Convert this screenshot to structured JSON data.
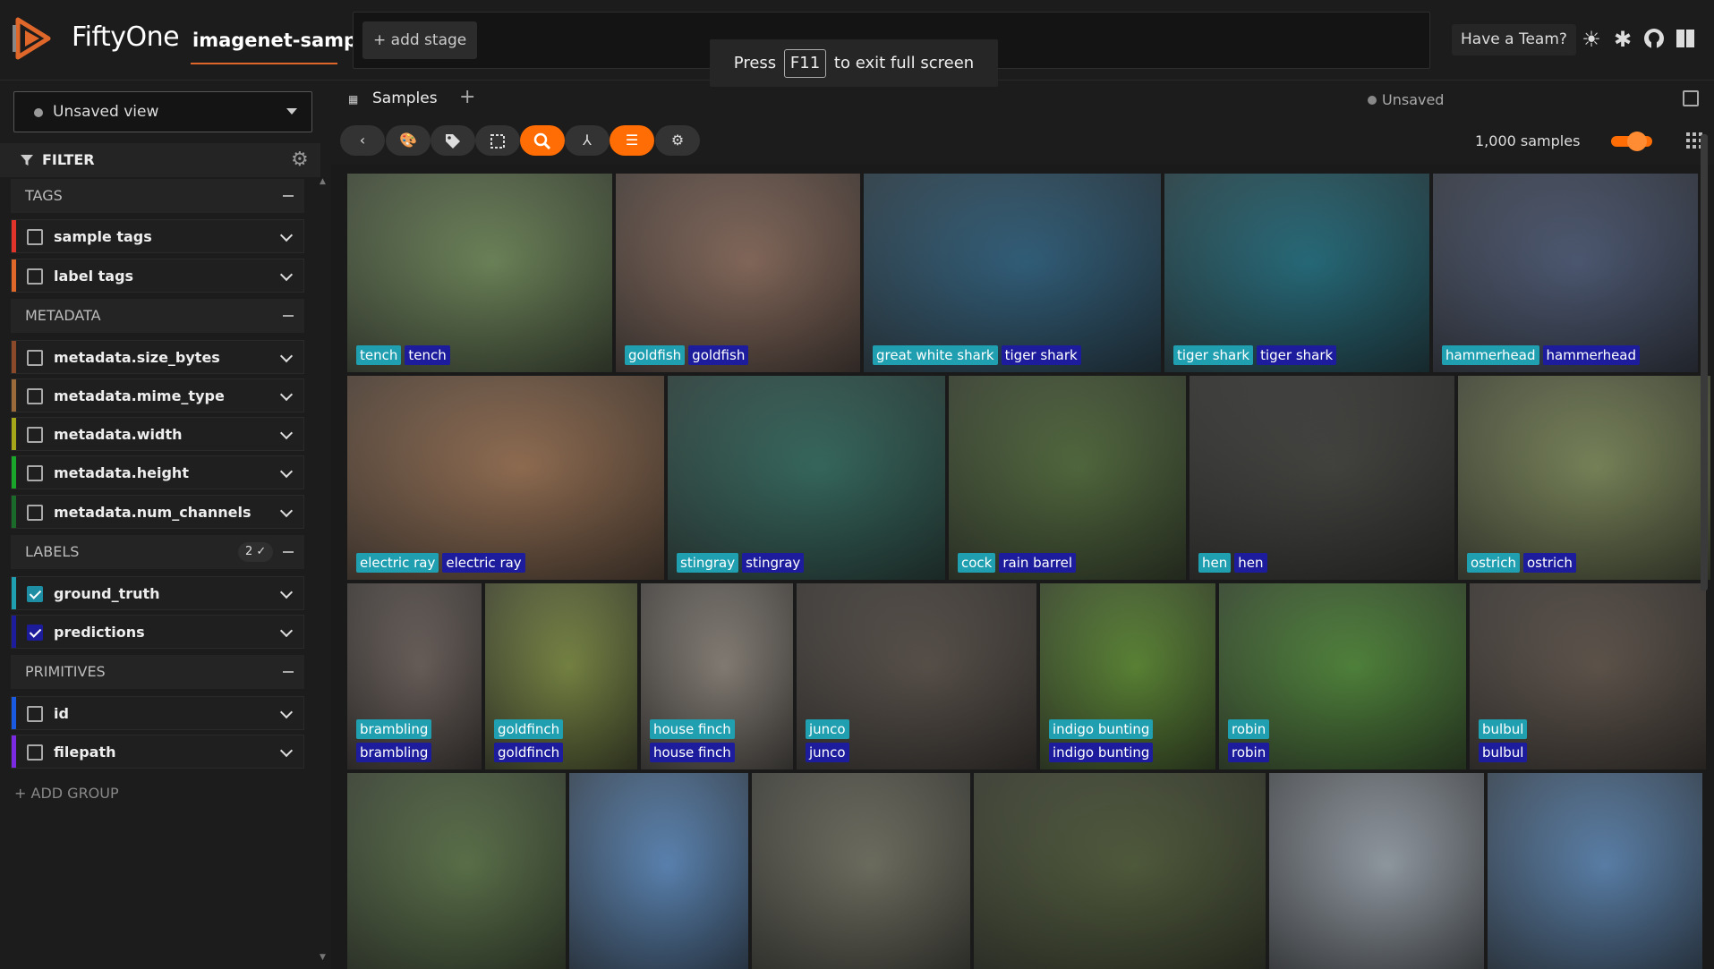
{
  "header": {
    "brand": "FiftyOne",
    "dataset": "imagenet-sample",
    "add_stage": "+ add stage",
    "fullscreen_notice": {
      "before": "Press",
      "key": "F11",
      "after": "to exit full screen"
    },
    "team_button": "Have a Team?",
    "icons": [
      "sun-icon",
      "slack-icon",
      "github-icon",
      "book-icon"
    ]
  },
  "sidebar": {
    "view_selector": "Unsaved view",
    "filter_title": "FILTER",
    "groups": {
      "tags": "TAGS",
      "metadata": "METADATA",
      "labels": "LABELS",
      "labels_badge": "2 ✓",
      "primitives": "PRIMITIVES"
    },
    "fields": {
      "sample_tags": "sample tags",
      "label_tags": "label tags",
      "size_bytes": "metadata.size_bytes",
      "mime_type": "metadata.mime_type",
      "width": "metadata.width",
      "height": "metadata.height",
      "num_channels": "metadata.num_channels",
      "ground_truth": "ground_truth",
      "predictions": "predictions",
      "id": "id",
      "filepath": "filepath"
    },
    "add_group": "+ ADD GROUP"
  },
  "main": {
    "tab": "Samples",
    "tab_add": "+",
    "unsaved": "Unsaved",
    "sample_count": "1,000 samples"
  },
  "colors": {
    "accent": "#ff6d04",
    "ground_truth": "#1f9fb0",
    "predictions": "#1c1c9c"
  },
  "samples": [
    {
      "gt": "tench",
      "pred": "tench",
      "bg": "#6f8a58"
    },
    {
      "gt": "goldfish",
      "pred": "goldfish",
      "bg": "#8a6a5a"
    },
    {
      "gt": "great white shark",
      "pred": "tiger shark",
      "bg": "#2a5f7f"
    },
    {
      "gt": "tiger shark",
      "pred": "tiger shark",
      "bg": "#1d6d7f"
    },
    {
      "gt": "hammerhead",
      "pred": "hammerhead",
      "bg": "#4a5876"
    },
    {
      "gt": "electric ray",
      "pred": "electric ray",
      "bg": "#9a7050"
    },
    {
      "gt": "stingray",
      "pred": "stingray",
      "bg": "#2f6a5e"
    },
    {
      "gt": "cock",
      "pred": "rain barrel",
      "bg": "#4f6a38"
    },
    {
      "gt": "hen",
      "pred": "hen",
      "bg": "#3e3e3a"
    },
    {
      "gt": "ostrich",
      "pred": "ostrich",
      "bg": "#7d8a58"
    },
    {
      "gt": "brambling",
      "pred": "brambling",
      "bg": "#6a5e58"
    },
    {
      "gt": "goldfinch",
      "pred": "goldfinch",
      "bg": "#7a8a3e"
    },
    {
      "gt": "house finch",
      "pred": "house finch",
      "bg": "#8a8278"
    },
    {
      "gt": "junco",
      "pred": "junco",
      "bg": "#574e46"
    },
    {
      "gt": "indigo bunting",
      "pred": "indigo bunting",
      "bg": "#5a8a2e"
    },
    {
      "gt": "robin",
      "pred": "robin",
      "bg": "#4e8a36"
    },
    {
      "gt": "bulbul",
      "pred": "bulbul",
      "bg": "#5e5248"
    },
    {
      "gt": "",
      "pred": "",
      "bg": "#5a7446"
    },
    {
      "gt": "",
      "pred": "",
      "bg": "#5a8ac0"
    },
    {
      "gt": "",
      "pred": "",
      "bg": "#707060"
    },
    {
      "gt": "",
      "pred": "",
      "bg": "#4e5a36"
    },
    {
      "gt": "",
      "pred": "",
      "bg": "#9aa4ae"
    },
    {
      "gt": "",
      "pred": "",
      "bg": "#5a86b6"
    }
  ]
}
